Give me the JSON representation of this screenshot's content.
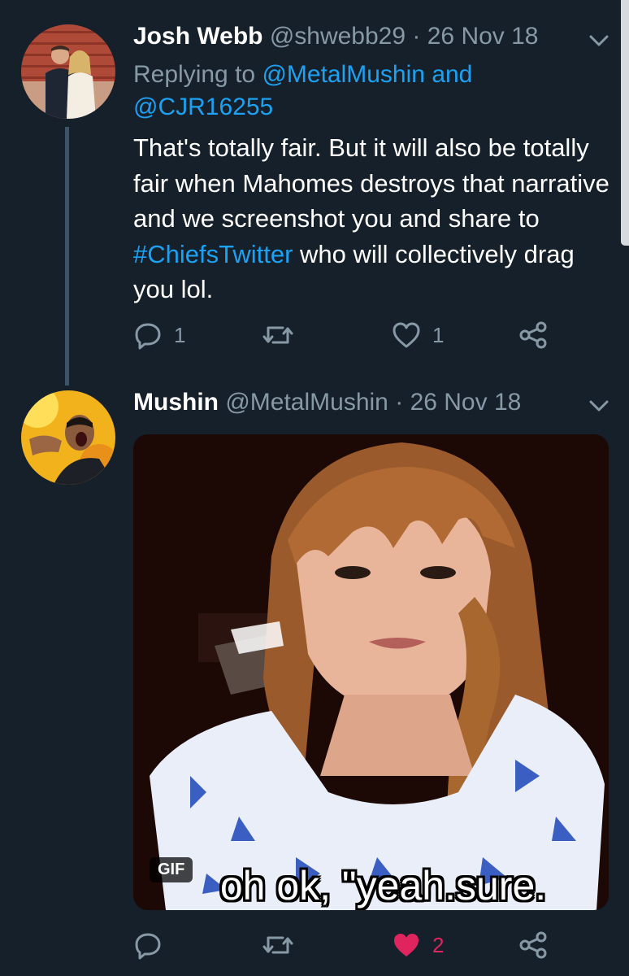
{
  "tweets": [
    {
      "name": "Josh Webb",
      "handle": "@shwebb29",
      "date": "26 Nov 18",
      "reply_prefix": "Replying to",
      "reply_to_1": "@MetalMushin",
      "reply_and": "and",
      "reply_to_2": "@CJR16255",
      "text_part1": "That's totally fair. But it will also be totally fair when Mahomes destroys that narrative and we screenshot you and share to",
      "hashtag": "#ChiefsTwitter",
      "text_part2": "who will collectively drag you lol.",
      "reply_count": "1",
      "retweet_count": "",
      "like_count": "1"
    },
    {
      "name": "Mushin",
      "handle": "@MetalMushin",
      "date": "26 Nov 18",
      "media_badge": "GIF",
      "media_caption": "oh ok, \"yeah.sure.",
      "reply_count": "",
      "retweet_count": "",
      "like_count": "2"
    }
  ],
  "dot": "·",
  "colors": {
    "background": "#15202b",
    "secondary_text": "#8899a6",
    "link": "#1da1f2",
    "like_active": "#e0245e"
  },
  "icons": [
    "reply-icon",
    "retweet-icon",
    "like-icon",
    "share-icon",
    "chevron-down-icon"
  ]
}
